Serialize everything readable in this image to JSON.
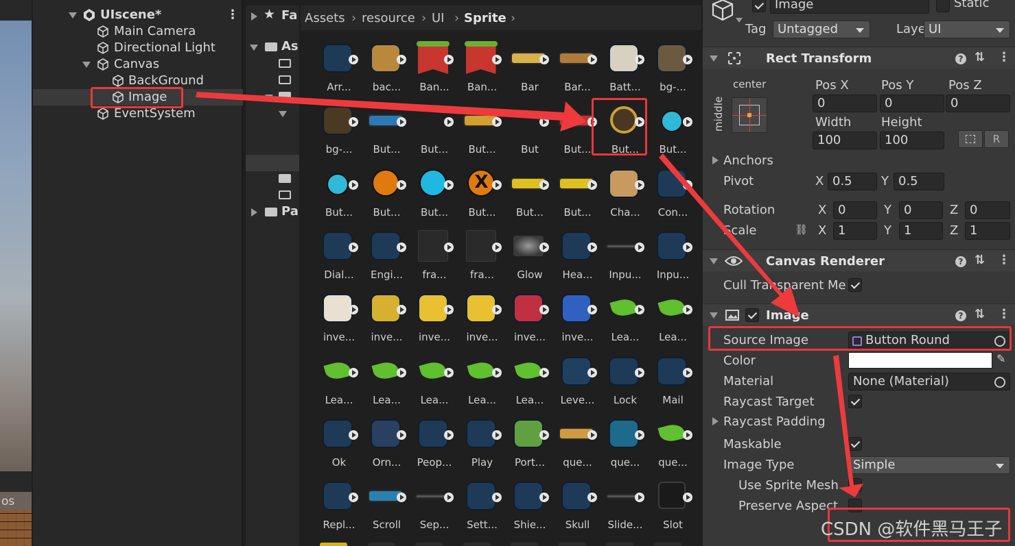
{
  "scene": {
    "mini_label": "os"
  },
  "hierarchy": {
    "scene_name": "UIscene*",
    "items": [
      {
        "label": "Main Camera"
      },
      {
        "label": "Directional Light"
      },
      {
        "label": "Canvas"
      },
      {
        "label": "BackGround"
      },
      {
        "label": "Image"
      },
      {
        "label": "EventSystem"
      }
    ]
  },
  "project": {
    "tree": [
      "Fa",
      "As",
      "Pa"
    ],
    "breadcrumb": [
      "Assets",
      "resource",
      "UI",
      "Sprite"
    ],
    "assets": [
      "Arr...",
      "bac...",
      "Ban...",
      "Ban...",
      "Bar",
      "Bar...",
      "Batt...",
      "bg-...",
      "bg-...",
      "But...",
      "But...",
      "But...",
      "But",
      "But...",
      "But...",
      "But...",
      "But...",
      "But...",
      "But...",
      "But...",
      "But...",
      "But...",
      "Cha...",
      "Con...",
      "Dial...",
      "Engi...",
      "fra...",
      "fra...",
      "Glow",
      "Hea...",
      "Inpu...",
      "Inpu...",
      "inve...",
      "inve...",
      "inve...",
      "inve...",
      "inve...",
      "inve...",
      "Lea...",
      "Lea...",
      "Lea...",
      "Lea...",
      "Lea...",
      "Lea...",
      "Lea...",
      "Leve...",
      "Lock",
      "Mail",
      "Ok",
      "Orn...",
      "Peop...",
      "Play",
      "Port...",
      "que...",
      "que...",
      "que...",
      "Repl...",
      "Scroll",
      "Sep...",
      "Sett...",
      "Shie...",
      "Skull",
      "Slide...",
      "Slot"
    ]
  },
  "inspector": {
    "object_name": "Image",
    "static_label": "Static",
    "tag_label": "Tag",
    "tag_value": "Untagged",
    "layer_label": "Layer",
    "layer_value": "UI",
    "rect": {
      "title": "Rect Transform",
      "anchor_h": "center",
      "anchor_v": "middle",
      "pos_x_label": "Pos X",
      "pos_y_label": "Pos Y",
      "pos_z_label": "Pos Z",
      "pos_x": "0",
      "pos_y": "0",
      "pos_z": "0",
      "width_label": "Width",
      "height_label": "Height",
      "width": "100",
      "height": "100",
      "r_button": "R",
      "anchors_label": "Anchors",
      "pivot_label": "Pivot",
      "pivot_x": "0.5",
      "pivot_y": "0.5",
      "rotation_label": "Rotation",
      "rot_x": "0",
      "rot_y": "0",
      "rot_z": "0",
      "scale_label": "Scale",
      "scale_x": "1",
      "scale_y": "1",
      "scale_z": "1",
      "axis_x": "X",
      "axis_y": "Y",
      "axis_z": "Z"
    },
    "canvas_renderer": {
      "title": "Canvas Renderer",
      "cull_label": "Cull Transparent Me"
    },
    "image": {
      "title": "Image",
      "source_label": "Source Image",
      "source_value": "Button Round",
      "color_label": "Color",
      "material_label": "Material",
      "material_value": "None (Material)",
      "raycast_target_label": "Raycast Target",
      "raycast_padding_label": "Raycast Padding",
      "maskable_label": "Maskable",
      "image_type_label": "Image Type",
      "image_type_value": "Simple",
      "use_sprite_mesh_label": "Use Sprite Mesh",
      "preserve_aspect_label": "Preserve Aspect"
    }
  },
  "watermark": "CSDN @软件黑马王子",
  "colors": {
    "highlight": "#e8383c",
    "panel": "#383838",
    "field": "#2a2a2a"
  }
}
